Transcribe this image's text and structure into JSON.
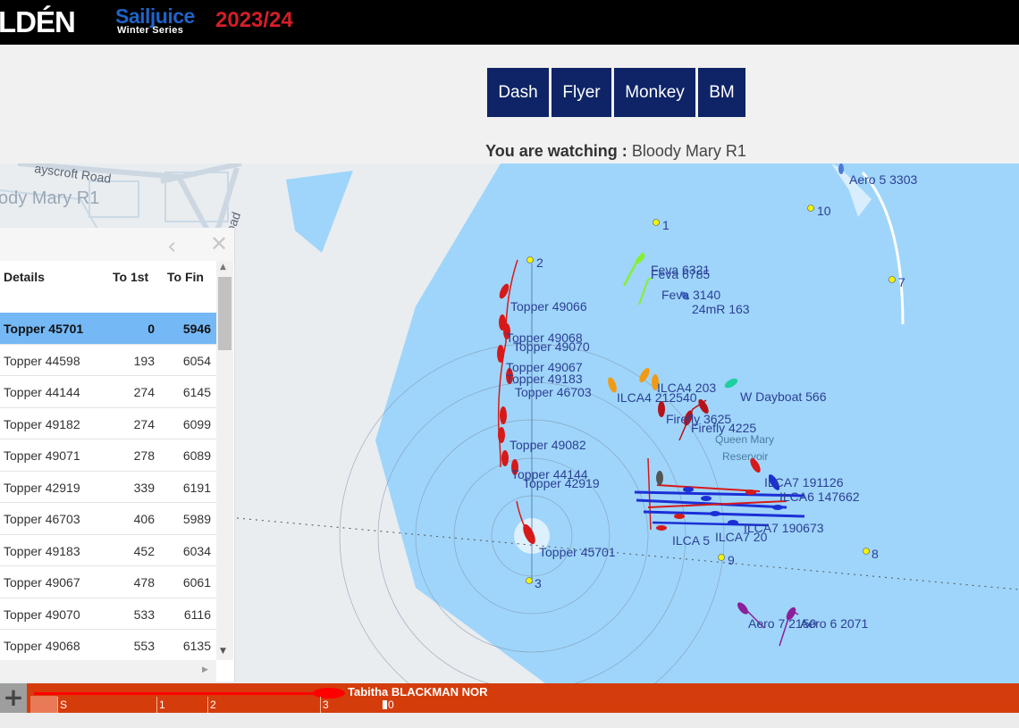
{
  "header": {
    "brand": "LDÉN",
    "series_name": "Sailjuice",
    "series_sub": "Winter Series",
    "season": "2023/24"
  },
  "nav": {
    "buttons": [
      "Dash",
      "Flyer",
      "Monkey",
      "BM"
    ]
  },
  "watching": {
    "prefix": "You are watching :",
    "race": "Bloody Mary R1"
  },
  "map": {
    "watermark_race": "ody Mary R1",
    "streets": [
      "ayscroft Road",
      "Road"
    ],
    "reservoir_label": [
      "Queen Mary",
      "Reservoir"
    ],
    "marks": [
      "1",
      "2",
      "3",
      "7",
      "8",
      "9",
      "10"
    ],
    "boat_labels": [
      "Aero 5 3303",
      "Feva 6321",
      "Feva 6785",
      "Feva 3140",
      "24mR 163",
      "Topper 49066",
      "Topper 49068",
      "Topper 49070",
      "Topper 49067",
      "Topper 49183",
      "Topper 46703",
      "ILCA4 203",
      "ILCA4 212540",
      "W Dayboat 566",
      "Firefly 3625",
      "Firefly 4225",
      "Topper 49082",
      "Topper 44144",
      "Topper 42919",
      "ILCA7 191126",
      "ILCA6 147662",
      "ILCA7 190673",
      "ILCA 5",
      "ILCA7 20",
      "Topper 45701",
      "Aero 7 2150",
      "Aero 6 2071"
    ],
    "colors": {
      "water": "#9fd5fa",
      "land": "#e9edf0",
      "topper": "#d71919",
      "ilca": "#1b2fd6"
    }
  },
  "panel": {
    "back_icon": "‹",
    "close_icon": "✕",
    "columns": [
      "Details",
      "To 1st",
      "To Fin"
    ],
    "rows": [
      {
        "name": "Topper 45701",
        "to_first": "0",
        "to_fin": "5946",
        "selected": true
      },
      {
        "name": "Topper 44598",
        "to_first": "193",
        "to_fin": "6054"
      },
      {
        "name": "Topper 44144",
        "to_first": "274",
        "to_fin": "6145"
      },
      {
        "name": "Topper 49182",
        "to_first": "274",
        "to_fin": "6099"
      },
      {
        "name": "Topper 49071",
        "to_first": "278",
        "to_fin": "6089"
      },
      {
        "name": "Topper 42919",
        "to_first": "339",
        "to_fin": "6191"
      },
      {
        "name": "Topper 46703",
        "to_first": "406",
        "to_fin": "5989"
      },
      {
        "name": "Topper 49183",
        "to_first": "452",
        "to_fin": "6034"
      },
      {
        "name": "Topper 49067",
        "to_first": "478",
        "to_fin": "6061"
      },
      {
        "name": "Topper 49070",
        "to_first": "533",
        "to_fin": "6116"
      },
      {
        "name": "Topper 49068",
        "to_first": "553",
        "to_fin": "6135"
      }
    ]
  },
  "timeline": {
    "zoom_label": "+",
    "boat_name": "Tabitha BLACKMAN NOR",
    "ticks": [
      "S",
      "1",
      "2",
      "3"
    ],
    "cursor_label": "0"
  }
}
